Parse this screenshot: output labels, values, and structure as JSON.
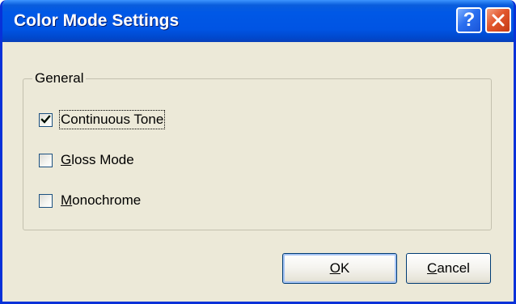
{
  "window": {
    "title": "Color Mode Settings",
    "help_glyph": "?",
    "help_icon": "help-icon",
    "close_icon": "close-icon"
  },
  "group": {
    "label": "General",
    "options": [
      {
        "mnemonic": "",
        "rest": "Continuous Tone",
        "checked": true
      },
      {
        "mnemonic": "G",
        "rest": "loss Mode",
        "checked": false
      },
      {
        "mnemonic": "M",
        "rest": "onochrome",
        "checked": false
      }
    ]
  },
  "buttons": {
    "ok_mnemonic": "O",
    "ok_rest": "K",
    "cancel_mnemonic": "C",
    "cancel_rest": "ancel"
  },
  "colors": {
    "titlebar": "#0054e3",
    "dialog_bg": "#ece9d8",
    "close_button": "#e2562c",
    "help_button": "#2a6ff0"
  }
}
